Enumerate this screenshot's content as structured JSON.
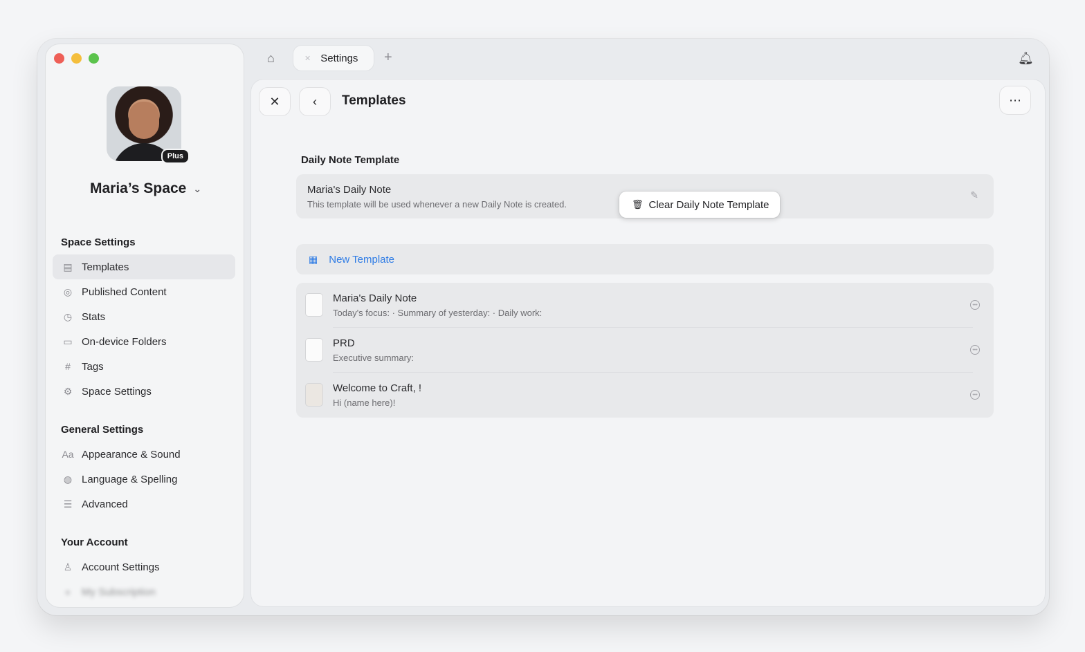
{
  "sidebar": {
    "space_name": "Maria’s Space",
    "plan_badge": "Plus",
    "sections": [
      {
        "title": "Space Settings"
      },
      {
        "title": "General Settings"
      },
      {
        "title": "Your Account"
      }
    ],
    "items": [
      {
        "label": "Templates",
        "icon": "template-icon"
      },
      {
        "label": "Published Content",
        "icon": "publish-icon"
      },
      {
        "label": "Stats",
        "icon": "clock-icon"
      },
      {
        "label": "On-device Folders",
        "icon": "folder-icon"
      },
      {
        "label": "Tags",
        "icon": "hash-icon"
      },
      {
        "label": "Space Settings",
        "icon": "gear-icon"
      },
      {
        "label": "Appearance & Sound",
        "icon": "text-icon"
      },
      {
        "label": "Language & Spelling",
        "icon": "globe-icon"
      },
      {
        "label": "Advanced",
        "icon": "sliders-icon"
      },
      {
        "label": "Account Settings",
        "icon": "person-icon"
      },
      {
        "label": "My Subscription",
        "icon": "subscription-icon"
      }
    ]
  },
  "topbar": {
    "tab_label": "Settings"
  },
  "main": {
    "title": "Templates",
    "daily_section_label": "Daily Note Template",
    "daily_card": {
      "title": "Maria's Daily Note",
      "description": "This template will be used whenever a new Daily Note is created."
    },
    "clear_button_label": "Clear Daily Note Template",
    "new_template_label": "New Template",
    "templates": [
      {
        "name": "Maria's Daily Note",
        "preview": "Today's focus: · Summary of yesterday: · Daily work:"
      },
      {
        "name": "PRD",
        "preview": "Executive summary:"
      },
      {
        "name": "Welcome to Craft, !",
        "preview": "Hi (name here)!"
      }
    ]
  }
}
